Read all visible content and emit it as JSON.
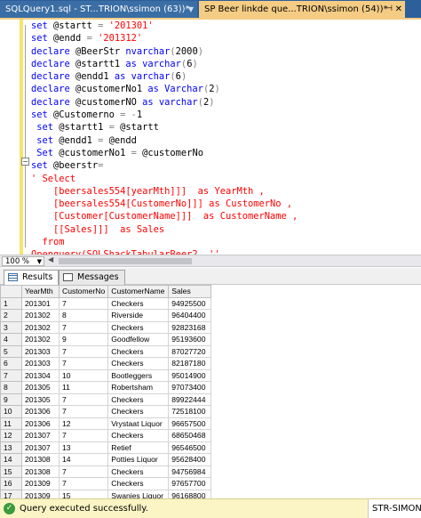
{
  "tabs": {
    "inactive_label": "SQLQuery1.sql - ST...TRION\\ssimon (63))*",
    "active_label": "SP Beer linkde que...TRION\\ssimon (54))*"
  },
  "editor": {
    "lines": [
      [
        [
          "kw",
          "set "
        ],
        [
          "id",
          "@startt "
        ],
        [
          "op",
          "= "
        ],
        [
          "str",
          "'201301'"
        ]
      ],
      [
        [
          "kw",
          "set "
        ],
        [
          "id",
          "@endd "
        ],
        [
          "op",
          "= "
        ],
        [
          "str",
          "'201312'"
        ]
      ],
      [
        [
          "kw",
          "declare "
        ],
        [
          "id",
          "@BeerStr "
        ],
        [
          "kw",
          "nvarchar"
        ],
        [
          "op",
          "("
        ],
        [
          "id",
          "2000"
        ],
        [
          "op",
          ")"
        ]
      ],
      [
        [
          "kw",
          "declare "
        ],
        [
          "id",
          "@startt1 "
        ],
        [
          "kw",
          "as varchar"
        ],
        [
          "op",
          "("
        ],
        [
          "id",
          "6"
        ],
        [
          "op",
          ")"
        ]
      ],
      [
        [
          "kw",
          "declare "
        ],
        [
          "id",
          "@endd1 "
        ],
        [
          "kw",
          "as varchar"
        ],
        [
          "op",
          "("
        ],
        [
          "id",
          "6"
        ],
        [
          "op",
          ")"
        ]
      ],
      [
        [
          "kw",
          "declare "
        ],
        [
          "id",
          "@customerNo1 "
        ],
        [
          "kw",
          "as Varchar"
        ],
        [
          "op",
          "("
        ],
        [
          "id",
          "2"
        ],
        [
          "op",
          ")"
        ]
      ],
      [
        [
          "kw",
          "declare "
        ],
        [
          "id",
          "@customerNO "
        ],
        [
          "kw",
          "as varchar"
        ],
        [
          "op",
          "("
        ],
        [
          "id",
          "2"
        ],
        [
          "op",
          ")"
        ]
      ],
      [
        [
          "kw",
          "set "
        ],
        [
          "id",
          "@Customerno "
        ],
        [
          "op",
          "= -"
        ],
        [
          "id",
          "1"
        ]
      ],
      [
        [
          "id",
          " "
        ],
        [
          "kw",
          "set "
        ],
        [
          "id",
          "@startt1 "
        ],
        [
          "op",
          "= "
        ],
        [
          "id",
          "@startt"
        ]
      ],
      [
        [
          "id",
          " "
        ],
        [
          "kw",
          "set "
        ],
        [
          "id",
          "@endd1 "
        ],
        [
          "op",
          "= "
        ],
        [
          "id",
          "@endd"
        ]
      ],
      [
        [
          "id",
          " "
        ],
        [
          "kw",
          "Set "
        ],
        [
          "id",
          "@customerNo1 "
        ],
        [
          "op",
          "= "
        ],
        [
          "id",
          "@customerNo"
        ]
      ],
      [
        [
          "kw",
          "set "
        ],
        [
          "id",
          "@beerstr"
        ],
        [
          "op",
          "="
        ]
      ],
      [
        [
          "str",
          "' Select"
        ]
      ],
      [
        [
          "str",
          "    [beersales554[yearMth]]]  as YearMth ,"
        ]
      ],
      [
        [
          "str",
          "    [beersales554[CustomerNo]]] as CustomerNo ,"
        ]
      ],
      [
        [
          "str",
          "    [Customer[CustomerName]]]  as CustomerName ,"
        ]
      ],
      [
        [
          "str",
          "    [[Sales]]]  as Sales"
        ]
      ],
      [
        [
          "str",
          "  from"
        ]
      ],
      [
        [
          "str",
          "Openquery(SQLShackTabularBeer2, ''"
        ]
      ]
    ]
  },
  "zoom": {
    "value": "100 %"
  },
  "result_tabs": {
    "results_label": "Results",
    "messages_label": "Messages"
  },
  "grid": {
    "columns": [
      "YearMth",
      "CustomerNo",
      "CustomerName",
      "Sales"
    ],
    "rows": [
      [
        "1",
        "201301",
        "7",
        "Checkers",
        "94925500"
      ],
      [
        "2",
        "201302",
        "8",
        "Riverside",
        "96404400"
      ],
      [
        "3",
        "201302",
        "7",
        "Checkers",
        "92823168"
      ],
      [
        "4",
        "201302",
        "9",
        "Goodfellow",
        "95193600"
      ],
      [
        "5",
        "201303",
        "7",
        "Checkers",
        "87027720"
      ],
      [
        "6",
        "201303",
        "7",
        "Checkers",
        "82187180"
      ],
      [
        "7",
        "201304",
        "10",
        "Bootleggers",
        "95014900"
      ],
      [
        "8",
        "201305",
        "11",
        "Robertsham",
        "97073400"
      ],
      [
        "9",
        "201305",
        "7",
        "Checkers",
        "89922444"
      ],
      [
        "10",
        "201306",
        "7",
        "Checkers",
        "72518100"
      ],
      [
        "11",
        "201306",
        "12",
        "Vrystaat Liquor",
        "96657500"
      ],
      [
        "12",
        "201307",
        "7",
        "Checkers",
        "68650468"
      ],
      [
        "13",
        "201307",
        "13",
        "Retief",
        "96546500"
      ],
      [
        "14",
        "201308",
        "14",
        "Potties Liquor",
        "95628400"
      ],
      [
        "15",
        "201308",
        "7",
        "Checkers",
        "94756984"
      ],
      [
        "16",
        "201309",
        "7",
        "Checkers",
        "97657700"
      ],
      [
        "17",
        "201309",
        "15",
        "Swanies Liquor",
        "96168800"
      ]
    ]
  },
  "status": {
    "message": "Query executed successfully.",
    "server": "STR-SIMON\\"
  }
}
